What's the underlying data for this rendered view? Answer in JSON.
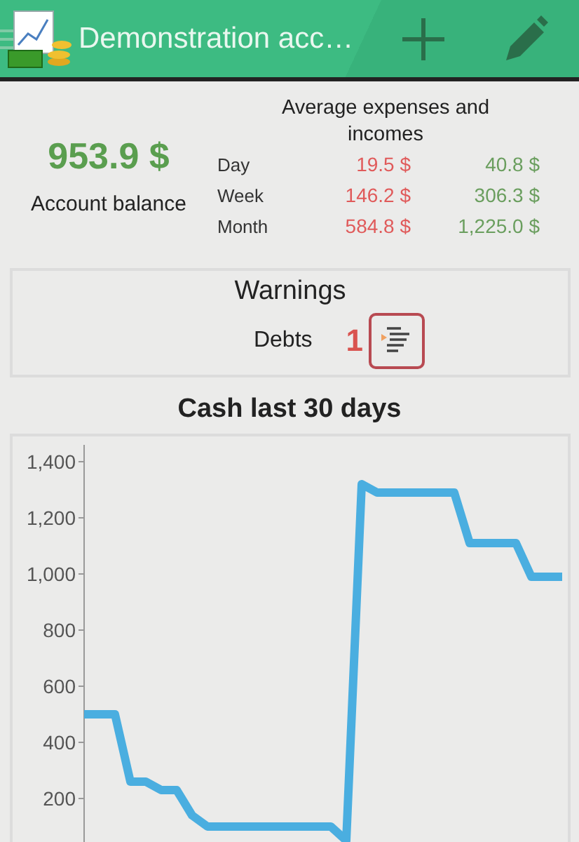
{
  "header": {
    "title": "Demonstration acc…"
  },
  "summary": {
    "balance": "953.9 $",
    "balance_label": "Account balance",
    "averages_title": "Average expenses and incomes",
    "rows": [
      {
        "period": "Day",
        "expense": "19.5 $",
        "income": "40.8 $"
      },
      {
        "period": "Week",
        "expense": "146.2 $",
        "income": "306.3 $"
      },
      {
        "period": "Month",
        "expense": "584.8 $",
        "income": "1,225.0 $"
      }
    ]
  },
  "warnings": {
    "title": "Warnings",
    "items": [
      {
        "label": "Debts",
        "count": "1"
      }
    ]
  },
  "chart": {
    "title": "Cash last 30 days",
    "chart_data": {
      "type": "line",
      "ylim": [
        0,
        1450
      ],
      "yticks": [
        {
          "value": 200,
          "label": "200"
        },
        {
          "value": 400,
          "label": "400"
        },
        {
          "value": 600,
          "label": "600"
        },
        {
          "value": 800,
          "label": "800"
        },
        {
          "value": 1000,
          "label": "1,000"
        },
        {
          "value": 1200,
          "label": "1,200"
        },
        {
          "value": 1400,
          "label": "1,400"
        }
      ],
      "series": [
        {
          "color": "#4aaee0",
          "values": [
            500,
            500,
            500,
            260,
            260,
            230,
            230,
            140,
            100,
            100,
            100,
            100,
            100,
            100,
            100,
            100,
            100,
            50,
            1320,
            1290,
            1290,
            1290,
            1290,
            1290,
            1290,
            1110,
            1110,
            1110,
            1110,
            990,
            990,
            990
          ]
        }
      ]
    }
  }
}
